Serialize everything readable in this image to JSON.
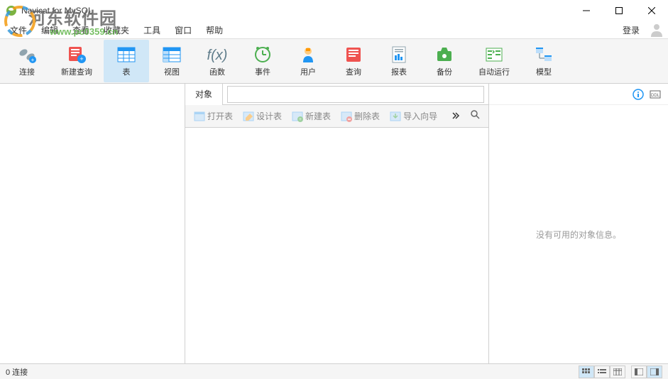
{
  "window": {
    "title": "Navicat for MySQL"
  },
  "menu": {
    "items": [
      "文件",
      "编辑",
      "查看",
      "收藏夹",
      "工具",
      "窗口",
      "帮助"
    ],
    "login": "登录"
  },
  "toolbar": {
    "items": [
      {
        "label": "连接",
        "name": "connect"
      },
      {
        "label": "新建查询",
        "name": "new-query"
      },
      {
        "label": "表",
        "name": "table",
        "active": true
      },
      {
        "label": "视图",
        "name": "view"
      },
      {
        "label": "函数",
        "name": "function"
      },
      {
        "label": "事件",
        "name": "event"
      },
      {
        "label": "用户",
        "name": "user"
      },
      {
        "label": "查询",
        "name": "query"
      },
      {
        "label": "报表",
        "name": "report"
      },
      {
        "label": "备份",
        "name": "backup"
      },
      {
        "label": "自动运行",
        "name": "automation"
      },
      {
        "label": "模型",
        "name": "model"
      }
    ]
  },
  "tabs": {
    "object": "对象"
  },
  "subToolbar": {
    "items": [
      {
        "label": "打开表",
        "name": "open-table"
      },
      {
        "label": "设计表",
        "name": "design-table"
      },
      {
        "label": "新建表",
        "name": "new-table"
      },
      {
        "label": "删除表",
        "name": "delete-table"
      },
      {
        "label": "导入向导",
        "name": "import-wizard"
      }
    ]
  },
  "rightPanel": {
    "empty": "没有可用的对象信息。"
  },
  "statusbar": {
    "connections": "0 连接"
  },
  "watermark": {
    "site": "河东软件园",
    "url": "www.pc0359.cn"
  }
}
